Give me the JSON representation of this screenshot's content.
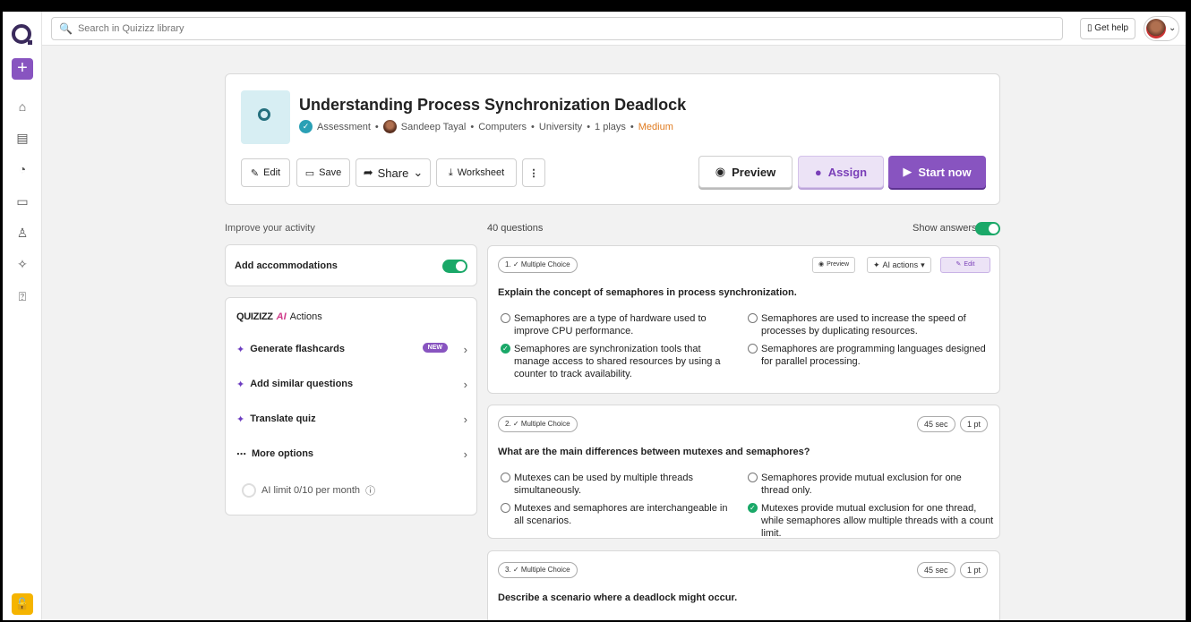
{
  "search": {
    "placeholder": "Search in Quizizz library"
  },
  "topbar": {
    "get_help": "Get help"
  },
  "quiz": {
    "title": "Understanding Process Synchronization Deadlock",
    "type": "Assessment",
    "author": "Sandeep Tayal",
    "subject": "Computers",
    "level": "University",
    "plays": "1 plays",
    "difficulty": "Medium"
  },
  "toolbar": {
    "edit": "Edit",
    "save": "Save",
    "share": "Share",
    "worksheet": "Worksheet",
    "preview": "Preview",
    "assign": "Assign",
    "start_now": "Start now"
  },
  "left": {
    "improve": "Improve your activity",
    "accommodations": "Add accommodations",
    "ai_brand": "QUIZIZZ",
    "ai_suffix": "AI",
    "ai_actions": "Actions",
    "items": [
      {
        "label": "Generate flashcards",
        "badge": "NEW"
      },
      {
        "label": "Add similar questions"
      },
      {
        "label": "Translate quiz"
      },
      {
        "label": "More options"
      }
    ],
    "ai_limit": "AI limit 0/10 per month"
  },
  "questions_header": {
    "count": "40 questions",
    "show_answers": "Show answers"
  },
  "q_actions": {
    "preview": "Preview",
    "ai_actions": "AI actions",
    "edit": "Edit"
  },
  "questions": [
    {
      "type": "1. ✓ Multiple Choice",
      "text": "Explain the concept of semaphores in process synchronization.",
      "options": [
        "Semaphores are a type of hardware used to improve CPU performance.",
        "Semaphores are used to increase the speed of processes by duplicating resources.",
        "Semaphores are synchronization tools that manage access to shared resources by using a counter to track availability.",
        "Semaphores are programming languages designed for parallel processing."
      ]
    },
    {
      "type": "2. ✓ Multiple Choice",
      "time": "45 sec",
      "points": "1 pt",
      "text": "What are the main differences between mutexes and semaphores?",
      "options": [
        "Mutexes can be used by multiple threads simultaneously.",
        "Semaphores provide mutual exclusion for one thread only.",
        "Mutexes and semaphores are interchangeable in all scenarios.",
        "Mutexes provide mutual exclusion for one thread, while semaphores allow multiple threads with a count limit."
      ]
    },
    {
      "type": "3. ✓ Multiple Choice",
      "time": "45 sec",
      "points": "1 pt",
      "text": "Describe a scenario where a deadlock might occur."
    }
  ]
}
